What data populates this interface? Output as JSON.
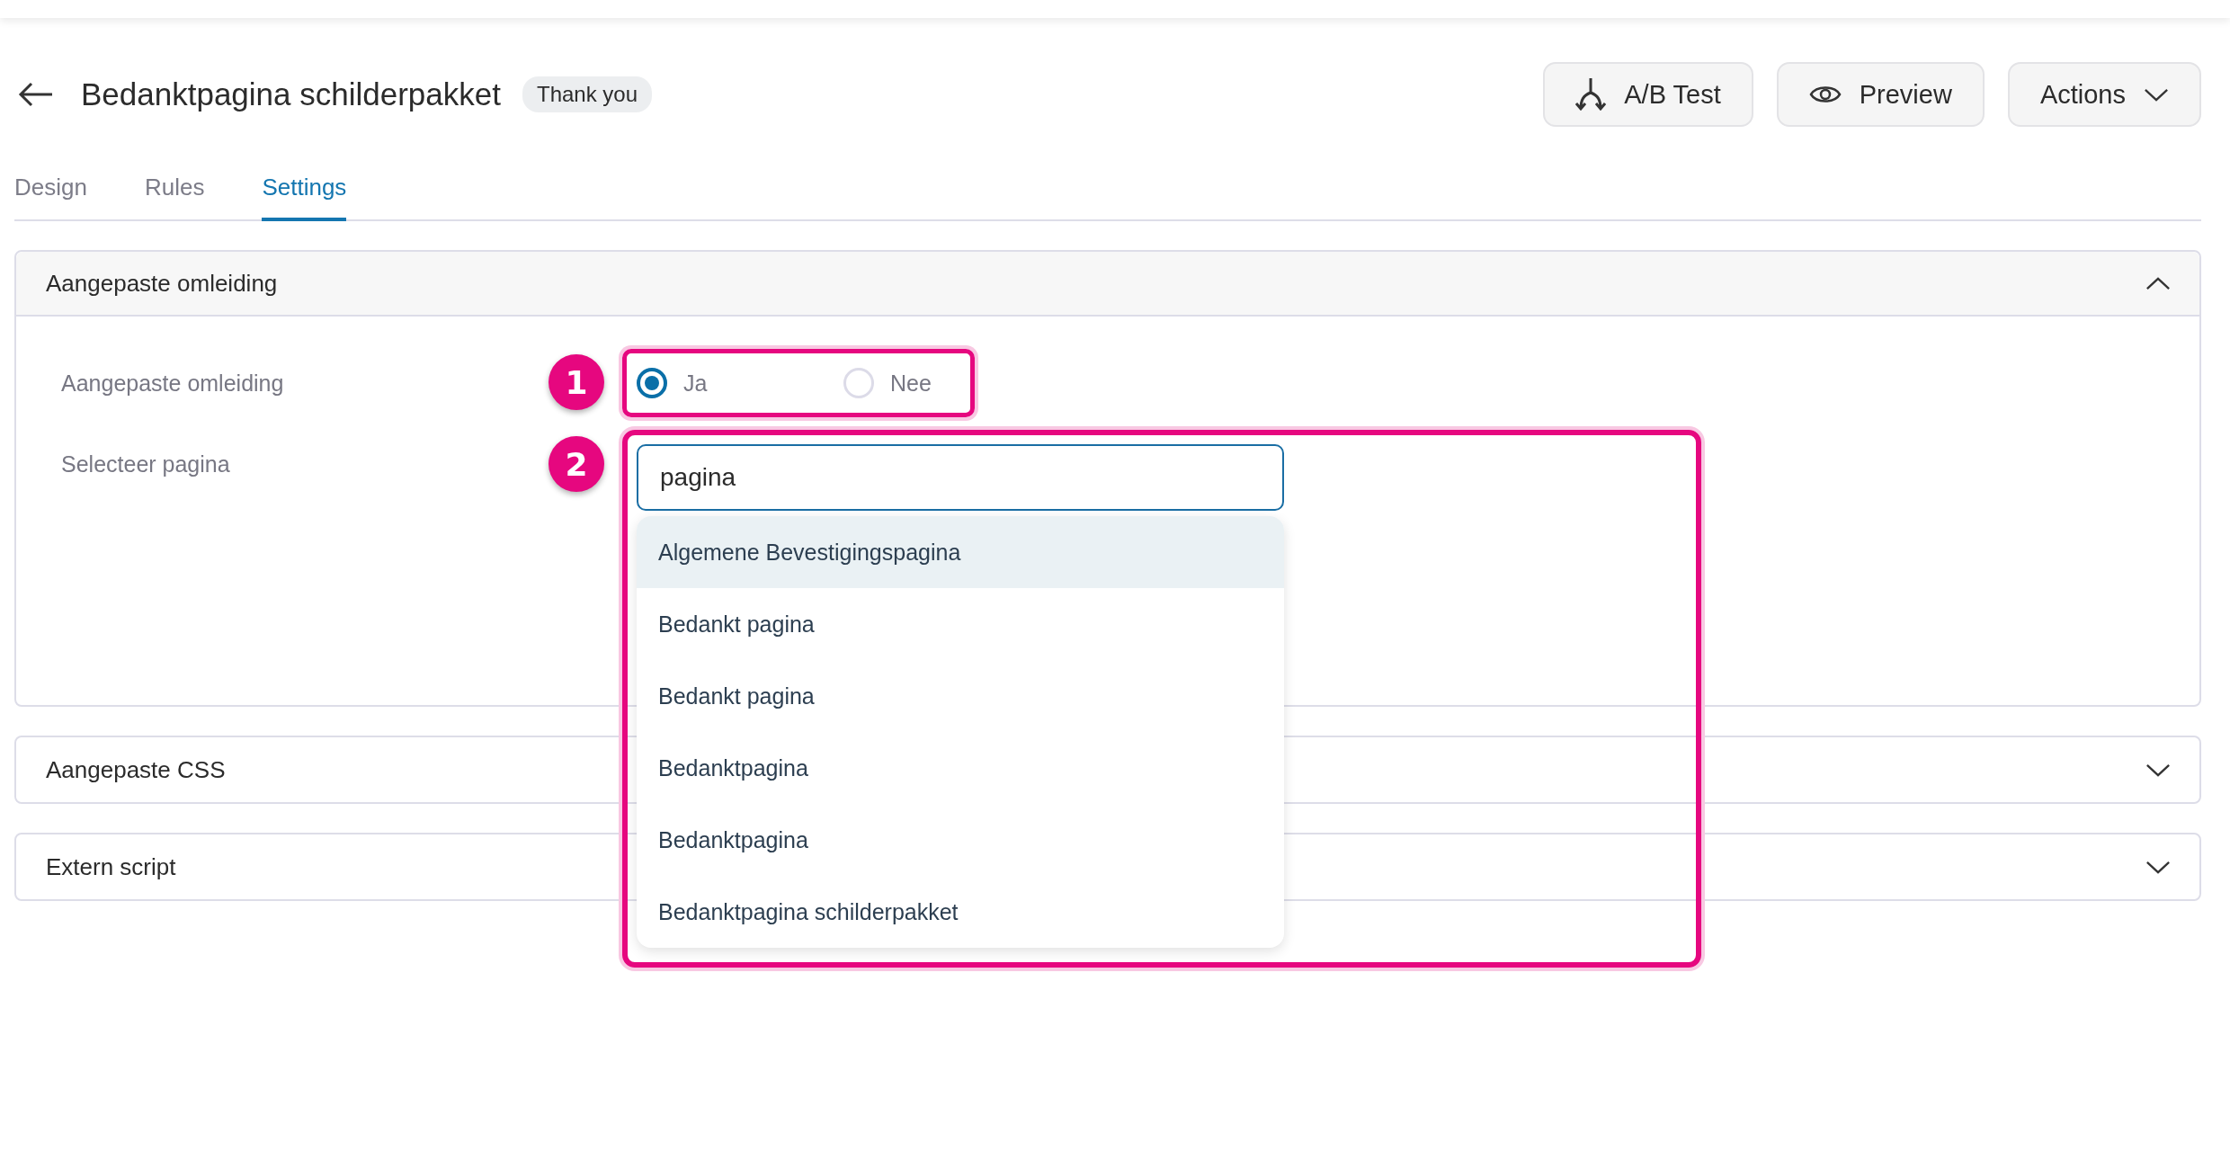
{
  "page": {
    "title": "Bedanktpagina schilderpakket",
    "badge": "Thank you"
  },
  "header_buttons": [
    {
      "label": "A/B Test",
      "kind": "split"
    },
    {
      "label": "Preview",
      "kind": "preview"
    },
    {
      "label": "Actions",
      "kind": "menu"
    }
  ],
  "tabs": [
    {
      "label": "Design",
      "selected": false
    },
    {
      "label": "Rules",
      "selected": false
    },
    {
      "label": "Settings",
      "selected": true
    }
  ],
  "sections": [
    {
      "title": "Aangepaste omleiding",
      "expanded": true,
      "fields": [
        {
          "kind": "radio",
          "label": "Aangepaste omleiding",
          "annotation": "1",
          "options": [
            {
              "label": "Ja",
              "selected": true
            },
            {
              "label": "Nee",
              "selected": false
            }
          ]
        },
        {
          "kind": "search",
          "label": "Selecteer pagina",
          "annotation": "2",
          "value": "pagina",
          "suggestions": [
            {
              "label": "Algemene Bevestigingspagina",
              "selected": true
            },
            {
              "label": "Bedankt pagina",
              "selected": false
            },
            {
              "label": "Bedankt pagina",
              "selected": false
            },
            {
              "label": "Bedanktpagina",
              "selected": false
            },
            {
              "label": "Bedanktpagina",
              "selected": false
            },
            {
              "label": "Bedanktpagina schilderpakket",
              "selected": false
            }
          ]
        }
      ]
    },
    {
      "title": "Aangepaste CSS",
      "expanded": false
    },
    {
      "title": "Extern script",
      "expanded": false
    }
  ]
}
